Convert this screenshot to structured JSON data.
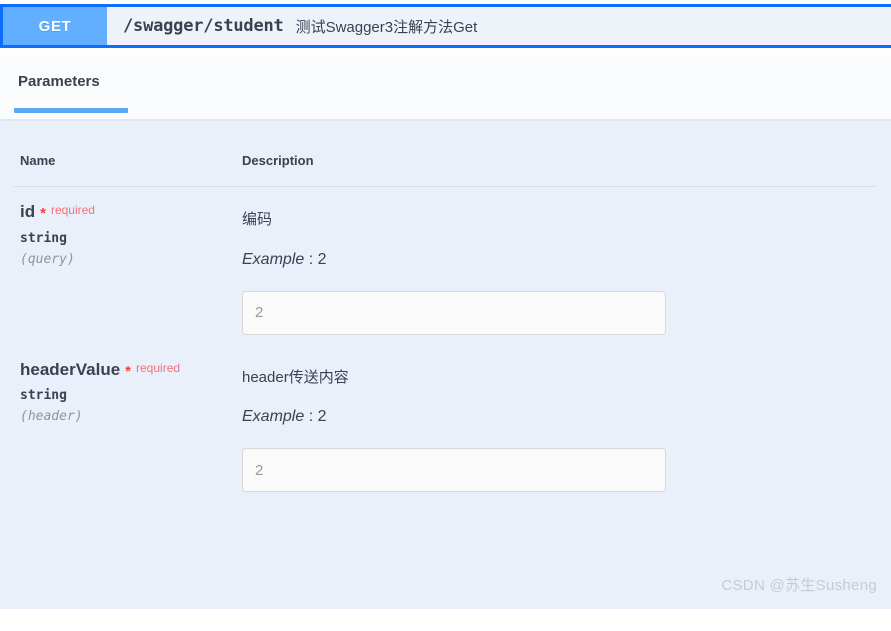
{
  "operation": {
    "method": "GET",
    "path": "/swagger/student",
    "summary": "测试Swagger3注解方法Get",
    "method_color": "#61affe",
    "border_color": "#0d6efd",
    "block_bg": "#e8f0fa"
  },
  "tabs": [
    {
      "label": "Parameters",
      "active": true
    }
  ],
  "table": {
    "headers": {
      "name": "Name",
      "description": "Description"
    },
    "rows": [
      {
        "name": "id",
        "required_star": "*",
        "required_label": "required",
        "type": "string",
        "location": "(query)",
        "description": "编码",
        "example_label": "Example",
        "example_separator": ":",
        "example_value": "2",
        "input_placeholder": "2",
        "input_value": ""
      },
      {
        "name": "headerValue",
        "required_star": "*",
        "required_label": "required",
        "type": "string",
        "location": "(header)",
        "description": "header传送内容",
        "example_label": "Example",
        "example_separator": ":",
        "example_value": "2",
        "input_placeholder": "2",
        "input_value": ""
      }
    ]
  },
  "watermark": "CSDN @苏生Susheng",
  "colors": {
    "required": "#f4707d",
    "required_star": "#f93e3e",
    "tab_underline": "#5aa7f5",
    "body_bg": "#e9f0f9",
    "text": "#3b4151"
  }
}
